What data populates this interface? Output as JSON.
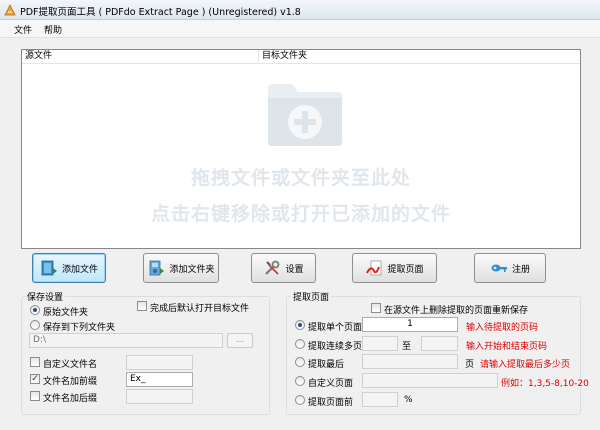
{
  "window": {
    "title": "PDF提取页面工具 ( PDFdo Extract Page ) (Unregistered) v1.8"
  },
  "menu": [
    {
      "label": "文件"
    },
    {
      "label": "帮助"
    }
  ],
  "file_list": {
    "columns": [
      "源文件",
      "目标文件夹"
    ],
    "hint_line1": "拖拽文件或文件夹至此处",
    "hint_line2": "点击右键移除或打开已添加的文件"
  },
  "toolbar": {
    "add_file": "添加文件",
    "add_folder": "添加文件夹",
    "settings": "设置",
    "extract": "提取页面",
    "register": "注册"
  },
  "save_settings": {
    "title": "保存设置",
    "original_folder": "原始文件夹",
    "save_to_folder": "保存到下列文件夹",
    "open_target_after": "完成后默认打开目标文件",
    "folder_path": "D:\\",
    "browse": "...",
    "custom_filename": "自定义文件名",
    "add_prefix": "文件名加前缀",
    "prefix_value": "Ex_",
    "add_suffix": "文件名加后缀",
    "selected_option": "原始文件夹"
  },
  "extract_settings": {
    "title": "提取页面",
    "delete_from_source": "在源文件上删除提取的页面重新保存",
    "single_page": "提取单个页面",
    "single_page_value": "1",
    "single_page_hint": "输入待提取的页码",
    "multi_page": "提取连续多页",
    "to_label": "至",
    "multi_page_hint": "输入开始和结束页码",
    "last_pages": "提取最后",
    "page_unit": "页",
    "last_pages_hint": "请输入提取最后多少页",
    "custom_pages": "自定义页面",
    "custom_example": "例如：1,3,5-8,10-20",
    "front_pages": "提取页面前",
    "percent": "%",
    "selected_option": "提取单个页面"
  }
}
